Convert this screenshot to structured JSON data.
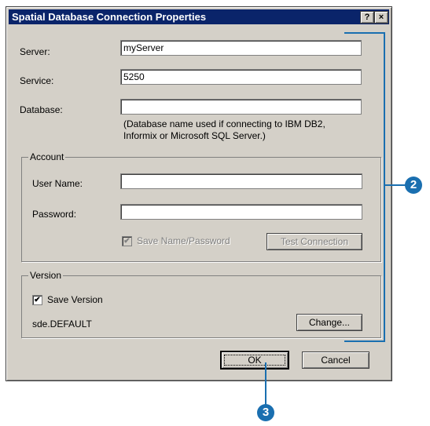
{
  "window": {
    "title": "Spatial Database Connection Properties",
    "help_glyph": "?",
    "close_glyph": "×"
  },
  "server": {
    "label": "Server:",
    "value": "myServer"
  },
  "service": {
    "label": "Service:",
    "value": "5250"
  },
  "database": {
    "label": "Database:",
    "value": "",
    "note_line1": "(Database name used if connecting to IBM DB2,",
    "note_line2": "Informix or Microsoft SQL Server.)"
  },
  "account": {
    "title": "Account",
    "username_label": "User Name:",
    "username_value": "",
    "password_label": "Password:",
    "password_value": "",
    "save_label": "Save Name/Password",
    "save_checked": true,
    "test_button": "Test Connection"
  },
  "version": {
    "title": "Version",
    "save_label": "Save Version",
    "save_checked": true,
    "value": "sde.DEFAULT",
    "change_button": "Change..."
  },
  "buttons": {
    "ok": "OK",
    "cancel": "Cancel"
  },
  "callouts": {
    "step2": "2",
    "step3": "3"
  },
  "colors": {
    "titlebar": "#0a246a",
    "dialog": "#d4d0c8",
    "callout": "#1a6fb0"
  }
}
